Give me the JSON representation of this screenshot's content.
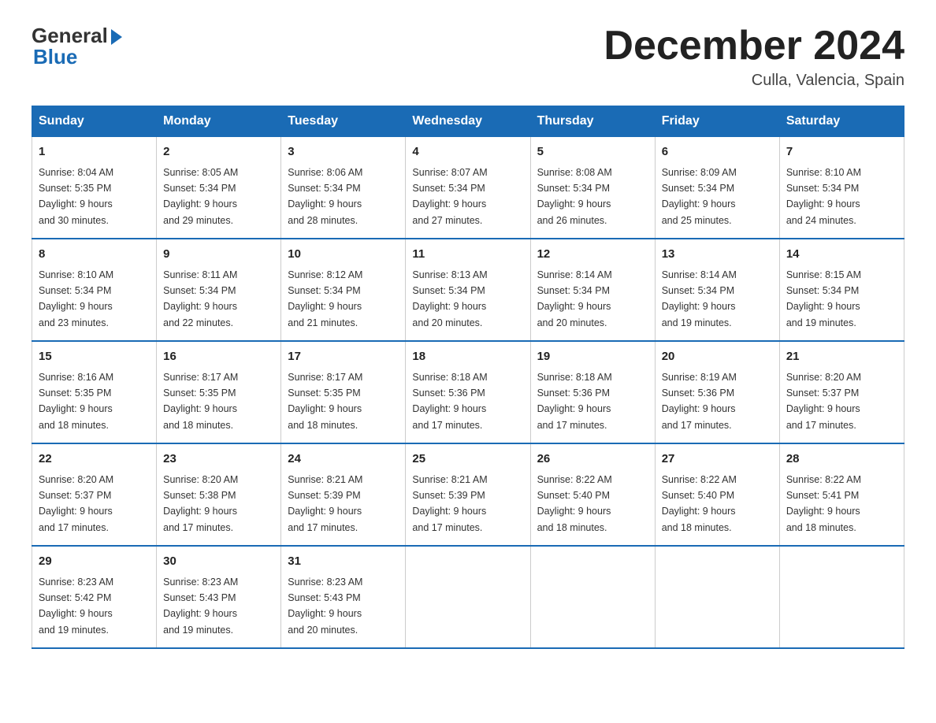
{
  "logo": {
    "general": "General",
    "blue": "Blue"
  },
  "title": "December 2024",
  "location": "Culla, Valencia, Spain",
  "days_of_week": [
    "Sunday",
    "Monday",
    "Tuesday",
    "Wednesday",
    "Thursday",
    "Friday",
    "Saturday"
  ],
  "weeks": [
    [
      {
        "day": "1",
        "sunrise": "8:04 AM",
        "sunset": "5:35 PM",
        "daylight": "9 hours and 30 minutes."
      },
      {
        "day": "2",
        "sunrise": "8:05 AM",
        "sunset": "5:34 PM",
        "daylight": "9 hours and 29 minutes."
      },
      {
        "day": "3",
        "sunrise": "8:06 AM",
        "sunset": "5:34 PM",
        "daylight": "9 hours and 28 minutes."
      },
      {
        "day": "4",
        "sunrise": "8:07 AM",
        "sunset": "5:34 PM",
        "daylight": "9 hours and 27 minutes."
      },
      {
        "day": "5",
        "sunrise": "8:08 AM",
        "sunset": "5:34 PM",
        "daylight": "9 hours and 26 minutes."
      },
      {
        "day": "6",
        "sunrise": "8:09 AM",
        "sunset": "5:34 PM",
        "daylight": "9 hours and 25 minutes."
      },
      {
        "day": "7",
        "sunrise": "8:10 AM",
        "sunset": "5:34 PM",
        "daylight": "9 hours and 24 minutes."
      }
    ],
    [
      {
        "day": "8",
        "sunrise": "8:10 AM",
        "sunset": "5:34 PM",
        "daylight": "9 hours and 23 minutes."
      },
      {
        "day": "9",
        "sunrise": "8:11 AM",
        "sunset": "5:34 PM",
        "daylight": "9 hours and 22 minutes."
      },
      {
        "day": "10",
        "sunrise": "8:12 AM",
        "sunset": "5:34 PM",
        "daylight": "9 hours and 21 minutes."
      },
      {
        "day": "11",
        "sunrise": "8:13 AM",
        "sunset": "5:34 PM",
        "daylight": "9 hours and 20 minutes."
      },
      {
        "day": "12",
        "sunrise": "8:14 AM",
        "sunset": "5:34 PM",
        "daylight": "9 hours and 20 minutes."
      },
      {
        "day": "13",
        "sunrise": "8:14 AM",
        "sunset": "5:34 PM",
        "daylight": "9 hours and 19 minutes."
      },
      {
        "day": "14",
        "sunrise": "8:15 AM",
        "sunset": "5:34 PM",
        "daylight": "9 hours and 19 minutes."
      }
    ],
    [
      {
        "day": "15",
        "sunrise": "8:16 AM",
        "sunset": "5:35 PM",
        "daylight": "9 hours and 18 minutes."
      },
      {
        "day": "16",
        "sunrise": "8:17 AM",
        "sunset": "5:35 PM",
        "daylight": "9 hours and 18 minutes."
      },
      {
        "day": "17",
        "sunrise": "8:17 AM",
        "sunset": "5:35 PM",
        "daylight": "9 hours and 18 minutes."
      },
      {
        "day": "18",
        "sunrise": "8:18 AM",
        "sunset": "5:36 PM",
        "daylight": "9 hours and 17 minutes."
      },
      {
        "day": "19",
        "sunrise": "8:18 AM",
        "sunset": "5:36 PM",
        "daylight": "9 hours and 17 minutes."
      },
      {
        "day": "20",
        "sunrise": "8:19 AM",
        "sunset": "5:36 PM",
        "daylight": "9 hours and 17 minutes."
      },
      {
        "day": "21",
        "sunrise": "8:20 AM",
        "sunset": "5:37 PM",
        "daylight": "9 hours and 17 minutes."
      }
    ],
    [
      {
        "day": "22",
        "sunrise": "8:20 AM",
        "sunset": "5:37 PM",
        "daylight": "9 hours and 17 minutes."
      },
      {
        "day": "23",
        "sunrise": "8:20 AM",
        "sunset": "5:38 PM",
        "daylight": "9 hours and 17 minutes."
      },
      {
        "day": "24",
        "sunrise": "8:21 AM",
        "sunset": "5:39 PM",
        "daylight": "9 hours and 17 minutes."
      },
      {
        "day": "25",
        "sunrise": "8:21 AM",
        "sunset": "5:39 PM",
        "daylight": "9 hours and 17 minutes."
      },
      {
        "day": "26",
        "sunrise": "8:22 AM",
        "sunset": "5:40 PM",
        "daylight": "9 hours and 18 minutes."
      },
      {
        "day": "27",
        "sunrise": "8:22 AM",
        "sunset": "5:40 PM",
        "daylight": "9 hours and 18 minutes."
      },
      {
        "day": "28",
        "sunrise": "8:22 AM",
        "sunset": "5:41 PM",
        "daylight": "9 hours and 18 minutes."
      }
    ],
    [
      {
        "day": "29",
        "sunrise": "8:23 AM",
        "sunset": "5:42 PM",
        "daylight": "9 hours and 19 minutes."
      },
      {
        "day": "30",
        "sunrise": "8:23 AM",
        "sunset": "5:43 PM",
        "daylight": "9 hours and 19 minutes."
      },
      {
        "day": "31",
        "sunrise": "8:23 AM",
        "sunset": "5:43 PM",
        "daylight": "9 hours and 20 minutes."
      },
      null,
      null,
      null,
      null
    ]
  ],
  "labels": {
    "sunrise": "Sunrise:",
    "sunset": "Sunset:",
    "daylight": "Daylight:"
  }
}
